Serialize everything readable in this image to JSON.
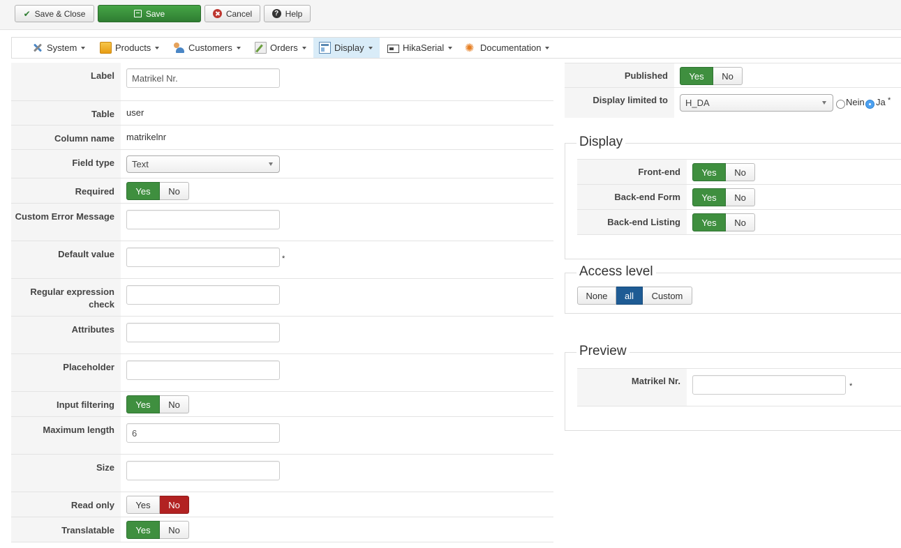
{
  "toolbar": {
    "save_close": "Save & Close",
    "save": "Save",
    "cancel": "Cancel",
    "help": "Help"
  },
  "menu": {
    "items": [
      "System",
      "Products",
      "Customers",
      "Orders",
      "Display",
      "HikaSerial",
      "Documentation"
    ],
    "active": "Display"
  },
  "form": {
    "label": {
      "title": "Label",
      "value": "Matrikel Nr."
    },
    "table": {
      "title": "Table",
      "value": "user"
    },
    "column_name": {
      "title": "Column name",
      "value": "matrikelnr"
    },
    "field_type": {
      "title": "Field type",
      "value": "Text"
    },
    "required": {
      "title": "Required",
      "yes": "Yes",
      "no": "No",
      "selected": "Yes"
    },
    "custom_error": {
      "title": "Custom Error Message",
      "value": ""
    },
    "default_value": {
      "title": "Default value",
      "value": "",
      "suffix": "*"
    },
    "regex": {
      "title": "Regular expression check",
      "value": ""
    },
    "attributes": {
      "title": "Attributes",
      "value": ""
    },
    "placeholder": {
      "title": "Placeholder",
      "value": ""
    },
    "input_filtering": {
      "title": "Input filtering",
      "yes": "Yes",
      "no": "No",
      "selected": "Yes"
    },
    "max_length": {
      "title": "Maximum length",
      "value": "6"
    },
    "size": {
      "title": "Size",
      "value": ""
    },
    "read_only": {
      "title": "Read only",
      "yes": "Yes",
      "no": "No",
      "selected": "No"
    },
    "translatable": {
      "title": "Translatable",
      "yes": "Yes",
      "no": "No",
      "selected": "Yes"
    }
  },
  "right": {
    "published": {
      "title": "Published",
      "yes": "Yes",
      "no": "No",
      "selected": "Yes"
    },
    "display_limited": {
      "title": "Display limited to",
      "value": "H_DA",
      "opt_no": "Nein",
      "opt_yes": "Ja",
      "suffix": "*",
      "selected": "Ja"
    },
    "display": {
      "legend": "Display",
      "front_end": {
        "title": "Front-end",
        "yes": "Yes",
        "no": "No",
        "selected": "Yes"
      },
      "backend_form": {
        "title": "Back-end Form",
        "yes": "Yes",
        "no": "No",
        "selected": "Yes"
      },
      "backend_listing": {
        "title": "Back-end Listing",
        "yes": "Yes",
        "no": "No",
        "selected": "Yes"
      }
    },
    "access": {
      "legend": "Access level",
      "options": [
        "None",
        "all",
        "Custom"
      ],
      "selected": "all"
    },
    "preview": {
      "legend": "Preview",
      "field_label": "Matrikel Nr.",
      "value": "",
      "suffix": "*"
    }
  },
  "colors": {
    "green": "#3f8f3f",
    "red": "#b22222",
    "blue": "#1e5b94",
    "menu_active": "#d9ecf8"
  }
}
